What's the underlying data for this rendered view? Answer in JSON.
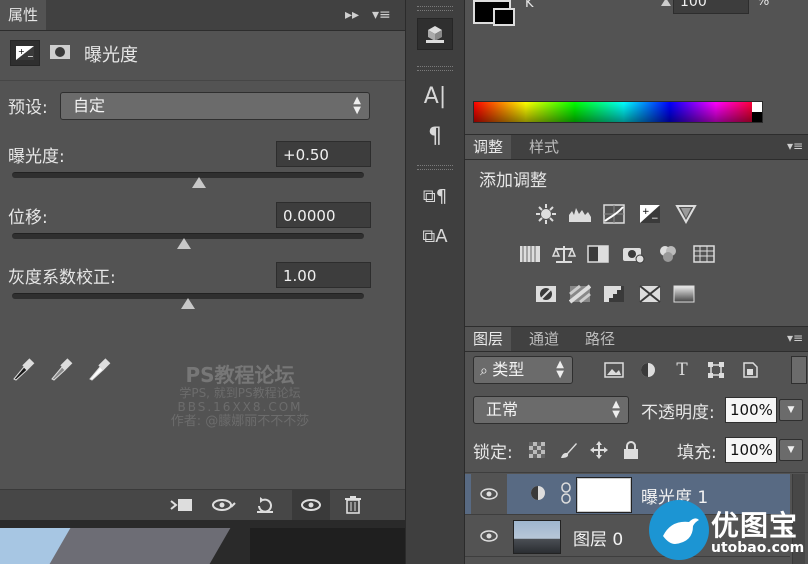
{
  "properties": {
    "tab_label": "属性",
    "panel_title": "曝光度",
    "preset_label": "预设:",
    "preset_value": "自定",
    "exposure": {
      "label": "曝光度:",
      "value": "+0.50",
      "slider_fraction": 0.53
    },
    "offset": {
      "label": "位移:",
      "value": "0.0000",
      "slider_fraction": 0.49
    },
    "gamma": {
      "label": "灰度系数校正:",
      "value": "1.00",
      "slider_fraction": 0.5
    }
  },
  "watermark": {
    "line1": "PS教程论坛",
    "line2": "学PS, 就到PS教程论坛",
    "line3": "BBS.16XX8.COM",
    "line4": "作者: @朦娜丽不不不莎"
  },
  "color": {
    "value": "100",
    "unit": "%",
    "k_label": "K"
  },
  "adjustments": {
    "tabs": [
      "调整",
      "样式"
    ],
    "title": "添加调整"
  },
  "layers": {
    "tabs": [
      "图层",
      "通道",
      "路径"
    ],
    "filter_value": "类型",
    "blend_mode": "正常",
    "opacity_label": "不透明度:",
    "opacity_value": "100%",
    "lock_label": "锁定:",
    "fill_label": "填充:",
    "fill_value": "100%",
    "items": [
      {
        "name": "曝光度 1"
      },
      {
        "name": "图层 0"
      }
    ]
  },
  "brand": {
    "name": "优图宝",
    "domain": "utobao.com"
  },
  "accent_colors": {
    "panel_bg": "#535353",
    "dark_bg": "#414141",
    "selected_layer": "#586a83",
    "brand_blue": "#1c95d3"
  }
}
